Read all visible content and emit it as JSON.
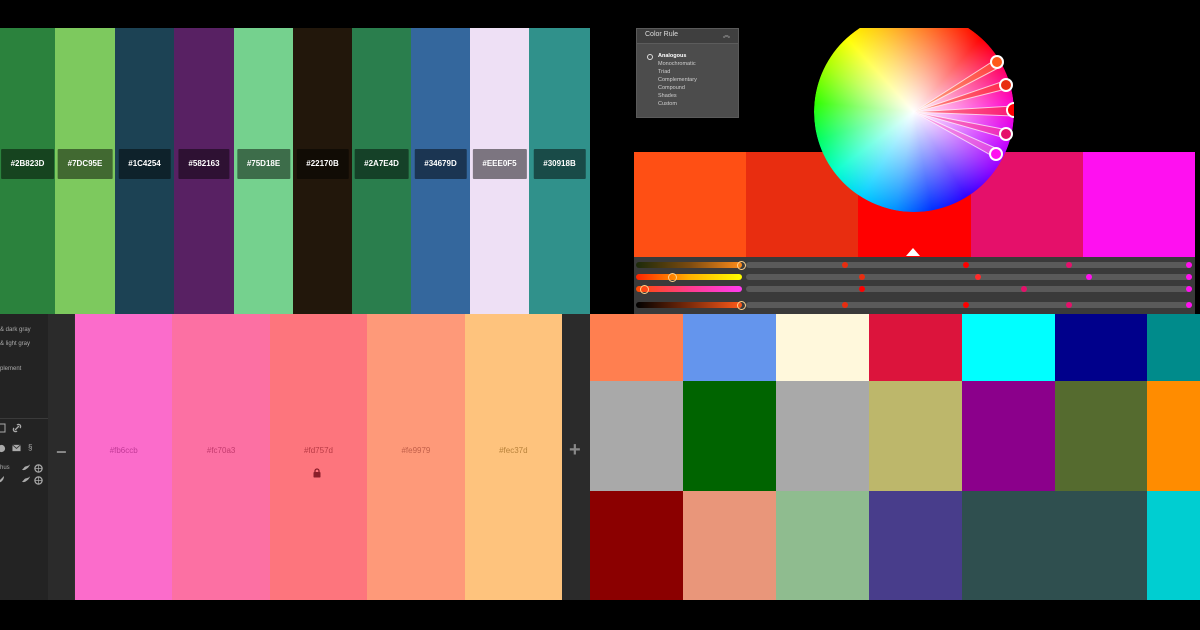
{
  "palette_strip": {
    "swatches": [
      {
        "hex": "#2B823D",
        "label": "#2B823D",
        "width": 55
      },
      {
        "hex": "#7DC95E",
        "label": "#7DC95E",
        "width": 60
      },
      {
        "hex": "#1C4254",
        "label": "#1C4254",
        "width": 59
      },
      {
        "hex": "#582163",
        "label": "#582163",
        "width": 60
      },
      {
        "hex": "#75D18E",
        "label": "#75D18E",
        "width": 59
      },
      {
        "hex": "#22170B",
        "label": "#22170B",
        "width": 59
      },
      {
        "hex": "#2A7E4D",
        "label": "#2A7E4D",
        "width": 59
      },
      {
        "hex": "#34679D",
        "label": "#34679D",
        "width": 59
      },
      {
        "hex": "#EEE0F5",
        "label": "#EEE0F5",
        "width": 59
      },
      {
        "hex": "#30918B",
        "label": "#30918B",
        "width": 61
      }
    ]
  },
  "color_rule": {
    "title": "Color Rule",
    "options": [
      "Analogous",
      "Monochromatic",
      "Triad",
      "Complementary",
      "Compound",
      "Shades",
      "Custom"
    ],
    "selected": "Analogous"
  },
  "harmony": {
    "swatches": [
      "#ff4f14",
      "#e82d10",
      "#ff0000",
      "#e5106a",
      "#ff10f0"
    ]
  },
  "palette_editor": {
    "sidebar_lines": [
      "& dark gray",
      "& light gray",
      "plement",
      "hus"
    ],
    "swatches": [
      {
        "hex": "#fb6ccb",
        "label": "#fb6ccb",
        "text_color": "#c23a97"
      },
      {
        "hex": "#fc70a3",
        "label": "#fc70a3",
        "text_color": "#c33a6e"
      },
      {
        "hex": "#fd757d",
        "label": "#fd757d",
        "text_color": "#b83a45",
        "locked": true
      },
      {
        "hex": "#fe9979",
        "label": "#fe9979",
        "text_color": "#c2604a"
      },
      {
        "hex": "#fec37d",
        "label": "#fec37d",
        "text_color": "#b8823b"
      }
    ],
    "minus": "−",
    "plus": "+"
  },
  "grid": {
    "rows": [
      [
        "#ff7f50",
        "#6495ed",
        "#fff8dc",
        "#dc143c",
        "#00ffff",
        "#00008b",
        "#008b8b"
      ],
      [
        "#a9a9a9",
        "#006400",
        "#a9a9a9",
        "#bdb76b",
        "#8b008b",
        "#556b2f",
        "#ff8c00"
      ],
      [
        "#8b0000",
        "#e9967a",
        "#8fbc8f",
        "#483d8b",
        "#2f4f4f",
        "#2f4f4f",
        "#00ced1"
      ]
    ]
  }
}
